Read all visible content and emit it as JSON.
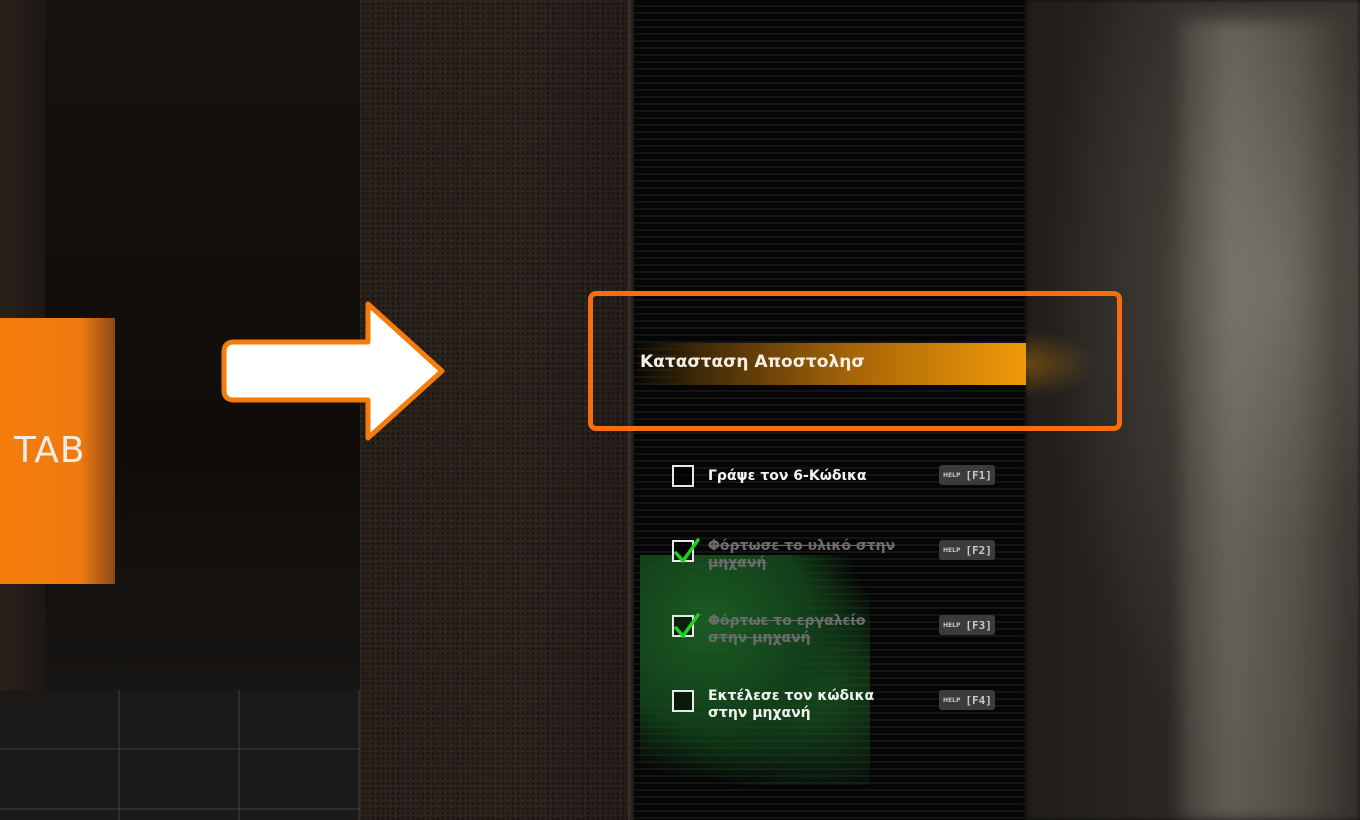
{
  "tab_tag": {
    "label": "TAB",
    "color": "#f57c0a"
  },
  "arrow": {
    "icon": "right-arrow-icon",
    "fill": "#ffffff",
    "stroke": "#f57c0a"
  },
  "highlight": {
    "color": "#f86c12"
  },
  "mission": {
    "title": "Κατασταση Αποστολησ",
    "bar_color": "#f09a08",
    "tasks": [
      {
        "text": "Γράψε τον 6-Κώδικα",
        "done": false,
        "help_word": "HELP",
        "key": "[F1]"
      },
      {
        "text": "Φόρτωσε το υλικό στην μηχανή",
        "done": true,
        "help_word": "HELP",
        "key": "[F2]"
      },
      {
        "text": "Φόρτωε το εργαλείο στην μηχανή",
        "done": true,
        "help_word": "HELP",
        "key": "[F3]"
      },
      {
        "text": "Εκτέλεσε τον κώδικα στην μηχανή",
        "done": false,
        "help_word": "HELP",
        "key": "[F4]"
      }
    ]
  }
}
